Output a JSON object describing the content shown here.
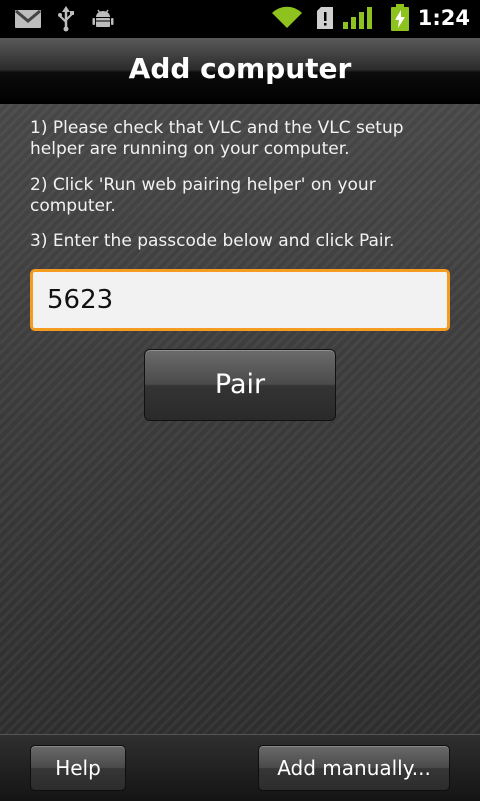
{
  "status_bar": {
    "time": "1:24",
    "icons": [
      "gmail-icon",
      "usb-icon",
      "android-debug-icon",
      "wifi-icon",
      "sd-card-alert-icon",
      "signal-icon",
      "battery-charging-icon"
    ],
    "accent_color": "#8ec21f"
  },
  "header": {
    "title": "Add computer"
  },
  "main": {
    "instructions": [
      "1) Please check that VLC and the VLC setup helper are running on your computer.",
      "2) Click 'Run web pairing helper' on your computer.",
      "3) Enter the passcode below and click Pair."
    ],
    "passcode_value": "5623",
    "focus_color": "#f39c1f",
    "pair_button": "Pair"
  },
  "bottom_bar": {
    "help_button": "Help",
    "add_manually_button": "Add manually..."
  }
}
